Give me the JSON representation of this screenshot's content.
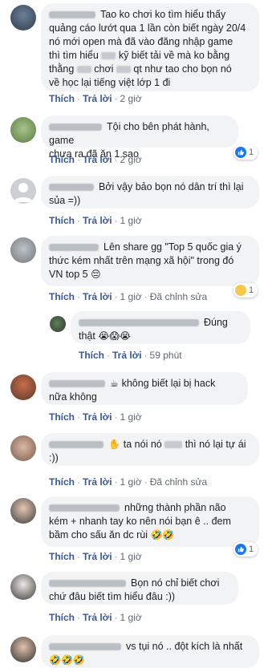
{
  "labels": {
    "like": "Thích",
    "reply": "Trả lời",
    "edited": "Đã chỉnh sửa",
    "dot": "·"
  },
  "comments": [
    {
      "text_l1": "Tao ko chơi ko tìm hiểu thấy",
      "text_l2": "quảng cáo lướt qua 1 lần còn biết ngày 20/4",
      "text_l3": "nó mới open mà đã vào đăng nhập game",
      "text_l4a": "thì tìm hiểu",
      "text_l4b": "kỹ biết tải về mà ko bằng",
      "text_l5a": "thằng",
      "text_l5b": "chơi",
      "text_l5c": "qt như tao cho bọn nó",
      "text_l6": "về học lại tiếng việt lớp 1 đi",
      "time": "2 giờ"
    },
    {
      "text_l1": "Tội cho bên phát hành, game",
      "text_l2": "chưa ra đã ăn 1 sao",
      "time": "2 giờ",
      "reaction_count": "1"
    },
    {
      "text_l1": "Bởi vậy bảo bọn nó dân trí thì lại",
      "text_l2": "sủa =))",
      "time": "1 giờ"
    },
    {
      "text_l1": "Lên share gg \"Top 5 quốc gia ý",
      "text_l2": "thức kém nhất trên mạng xã hội\" trong đó",
      "text_l3": "VN top 5",
      "emoji": "😔",
      "time": "1 giờ",
      "reaction_count": "1"
    },
    {
      "text_l1": "Đúng",
      "text_l2": "thật",
      "emoji": "😭😱😭",
      "time": "59 phút"
    },
    {
      "text_l1": "không biết lại bị hack",
      "text_l2": "nữa không",
      "time": "1 giờ"
    },
    {
      "text_l1a": "ta nói nó",
      "text_l1b": "thì nó lại tự ái",
      "text_l2": ":))",
      "time": "1 giờ"
    },
    {
      "text_l1": "những thành phần não",
      "text_l2": "kém + nhanh tay ko nên nói bạn ê .. đem",
      "text_l3": "bầm cho sấu ăn dc rùi",
      "emoji": "🤣🤣",
      "time": "1 giờ",
      "reaction_count": "1"
    },
    {
      "text_l1": "Bọn nó chỉ biết chơi",
      "text_l2": "chứ đâu biết tìm hiểu đâu :))",
      "time": "1 giờ"
    },
    {
      "text_l1": "vs tụi nó .. đột kích là nhất",
      "emoji": "🤣🤣🤣"
    }
  ]
}
